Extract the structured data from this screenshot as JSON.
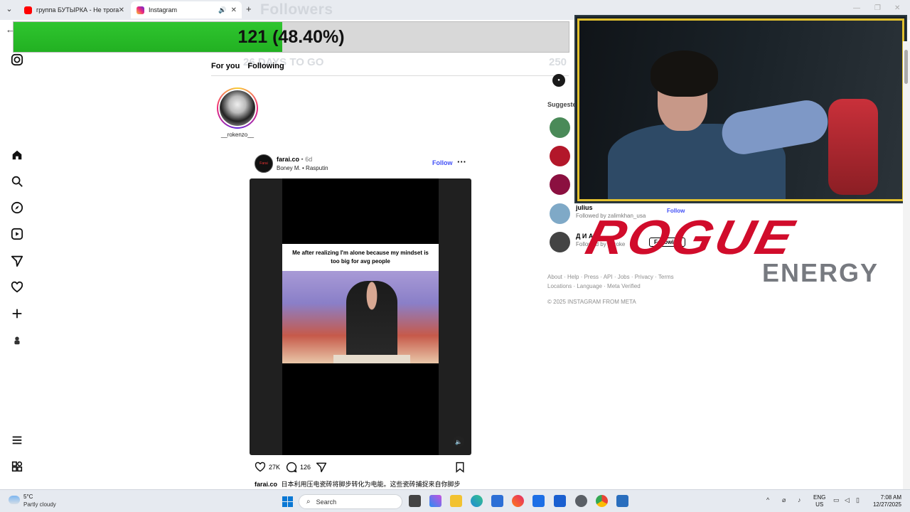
{
  "browser": {
    "tabs": [
      {
        "label": "группа БУТЫРКА - Не трогай с",
        "favicon_color": "#ff0000"
      },
      {
        "label": "Instagram",
        "favicon_color": "#e1306c"
      }
    ],
    "new_tab_label": "+"
  },
  "overlay": {
    "title": "Followers",
    "progress_text": "121 (48.40%)",
    "progress_fraction": 0.484,
    "days_left": "26 DAYS TO GO",
    "goal": "250"
  },
  "instagram": {
    "feed_tabs": [
      "For you",
      "Following"
    ],
    "story": {
      "username": "__rokenzo__"
    },
    "post": {
      "username": "farai.co",
      "time": "6d",
      "audio": "Boney M. • Rasputin",
      "follow_label": "Follow",
      "more_label": "···",
      "avatar_text": "Farai",
      "meme_caption": "Me after realizing I'm alone because my mindset is too big for avg people",
      "likes": "27K",
      "comments": "126",
      "caption_user": "farai.co",
      "caption_text": "日本利用压电瓷砖将脚步转化为电能。这些瓷砖捕捉来自你脚步"
    },
    "sidebar": {
      "suggested_label": "Suggested",
      "users": [
        {
          "name": "",
          "sub": "",
          "follow": "",
          "color": "#4a8a58"
        },
        {
          "name": "",
          "sub": "",
          "follow": "",
          "color": "#b3172a"
        },
        {
          "name": "",
          "sub": "",
          "follow": "",
          "color": "#8b1040"
        },
        {
          "name": "julius",
          "sub": "Followed by zalimkhan_usa",
          "follow": "Follow",
          "color": "#7fa9c7"
        },
        {
          "name": "Д И А Н",
          "sub": "Followed by __roke",
          "follow": "Following",
          "color": "#444444"
        }
      ],
      "footer_line1": "About · Help · Press · API · Jobs · Privacy · Terms",
      "footer_line2": "Locations · Language · Meta Verified",
      "copyright": "© 2025 INSTAGRAM FROM META"
    }
  },
  "sponsor": {
    "line1": "ROGUE",
    "line2": "ENERGY",
    "color": "#d10c2b"
  },
  "taskbar": {
    "weather_temp": "5°C",
    "weather_cond": "Partly cloudy",
    "search_placeholder": "Search",
    "lang1": "ENG",
    "lang2": "US",
    "time": "7:08 AM",
    "date": "12/27/2025"
  }
}
